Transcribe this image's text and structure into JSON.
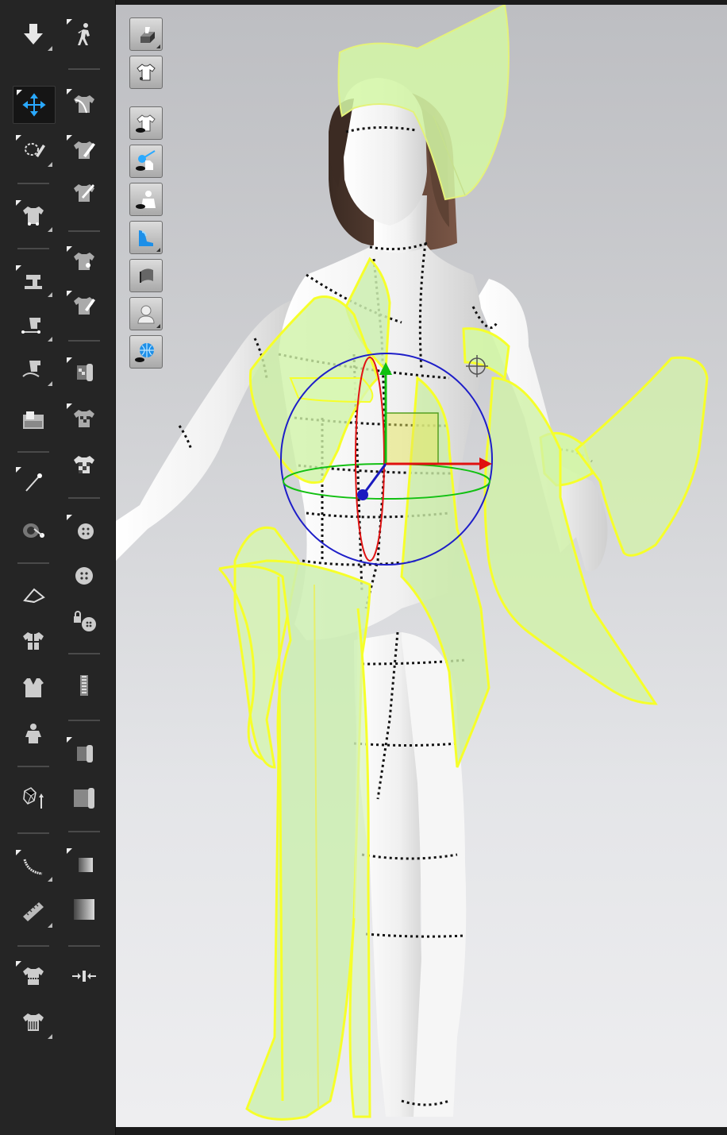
{
  "app": {
    "accent_color": "#2aa9ff",
    "garment_outline_color": "#f6ff2a",
    "garment_fill_color": "#d4f7a6",
    "avatar_color": "#f2f2f2",
    "gizmo_colors": {
      "x_axis": "#e01010",
      "y_axis": "#10c010",
      "z_ring": "#1010c0"
    }
  },
  "toolbar": {
    "col1": [
      {
        "icon": "arrow-down-icon",
        "name": "simulate-tool",
        "active": false
      },
      {
        "icon": "move-gizmo-icon",
        "name": "transform-tool",
        "active": true
      },
      {
        "icon": "lasso-pen-icon",
        "name": "select-lasso-tool",
        "active": false
      },
      {
        "icon": "shirt-pins-icon",
        "name": "fold-arrangement-tool",
        "active": false
      },
      {
        "icon": "sewing-machine-icon",
        "name": "segment-sewing-tool",
        "active": false
      },
      {
        "icon": "edit-sewing-icon",
        "name": "edit-sewing-tool",
        "active": false
      },
      {
        "icon": "free-sewing-icon",
        "name": "free-sewing-tool",
        "active": false
      },
      {
        "icon": "sewing-table-icon",
        "name": "sewing-table-tool",
        "active": false
      },
      {
        "icon": "pin-icon",
        "name": "pin-tool",
        "active": false
      },
      {
        "icon": "tack-icon",
        "name": "tack-tool",
        "active": false
      },
      {
        "icon": "fold-3d-icon",
        "name": "fold-3d-tool",
        "active": false
      },
      {
        "icon": "shirt-split-icon",
        "name": "garment-split-tool",
        "active": false
      },
      {
        "icon": "jacket-icon",
        "name": "jacket-tool",
        "active": false
      },
      {
        "icon": "avatar-small-icon",
        "name": "avatar-tool",
        "active": false
      },
      {
        "icon": "polygon-upload-icon",
        "name": "polygon-upload-tool",
        "active": false
      },
      {
        "icon": "tape-curve-icon",
        "name": "tape-measure-tool",
        "active": false
      },
      {
        "icon": "ruler-icon",
        "name": "ruler-tool",
        "active": false
      },
      {
        "icon": "shirt-measure-icon",
        "name": "garment-measure-tool",
        "active": false
      },
      {
        "icon": "shirt-fit-icon",
        "name": "garment-fit-tool",
        "active": false
      }
    ],
    "col2": [
      {
        "icon": "walking-avatar-icon",
        "name": "pose-tool"
      },
      {
        "icon": "shirt-curve-icon",
        "name": "edit-curvature-tool"
      },
      {
        "icon": "shirt-pen-icon",
        "name": "draw-seamline-tool"
      },
      {
        "icon": "shirt-brush-icon",
        "name": "brush-tool"
      },
      {
        "icon": "shirt-point-icon",
        "name": "add-point-tool"
      },
      {
        "icon": "shirt-knife-icon",
        "name": "cut-tool"
      },
      {
        "icon": "texture-roll-icon",
        "name": "texture-tool"
      },
      {
        "icon": "shirt-pattern-icon",
        "name": "pattern-texture-tool"
      },
      {
        "icon": "shirt-checker-icon",
        "name": "checker-texture-tool"
      },
      {
        "icon": "button-select-icon",
        "name": "select-button-tool"
      },
      {
        "icon": "button-icon",
        "name": "button-tool"
      },
      {
        "icon": "buttonhole-lock-icon",
        "name": "buttonhole-tool"
      },
      {
        "icon": "zipper-icon",
        "name": "zipper-tool"
      },
      {
        "icon": "roll-select-icon",
        "name": "select-fabric-roll-tool"
      },
      {
        "icon": "fabric-roll-icon",
        "name": "fabric-roll-tool"
      },
      {
        "icon": "gradient-select-icon",
        "name": "select-gradient-tool"
      },
      {
        "icon": "gradient-icon",
        "name": "gradient-tool"
      },
      {
        "icon": "compress-arrows-icon",
        "name": "compress-tool"
      }
    ]
  },
  "display_toolbar": [
    {
      "icon": "avatar-box-icon",
      "name": "show-avatar-box-button"
    },
    {
      "icon": "garment-icon",
      "name": "show-garment-button"
    },
    {
      "icon": "shirt-eye-icon",
      "name": "show-garment-eye-button"
    },
    {
      "icon": "pin-eye-icon",
      "name": "show-pins-button"
    },
    {
      "icon": "avatar-eye-icon",
      "name": "show-avatar-eye-button"
    },
    {
      "icon": "shoe-icon",
      "name": "show-shoes-button"
    },
    {
      "icon": "fabric-thickness-icon",
      "name": "fabric-thickness-button"
    },
    {
      "icon": "avatar-silhouette-icon",
      "name": "avatar-silhouette-button"
    },
    {
      "icon": "globe-eye-icon",
      "name": "environment-button"
    }
  ]
}
